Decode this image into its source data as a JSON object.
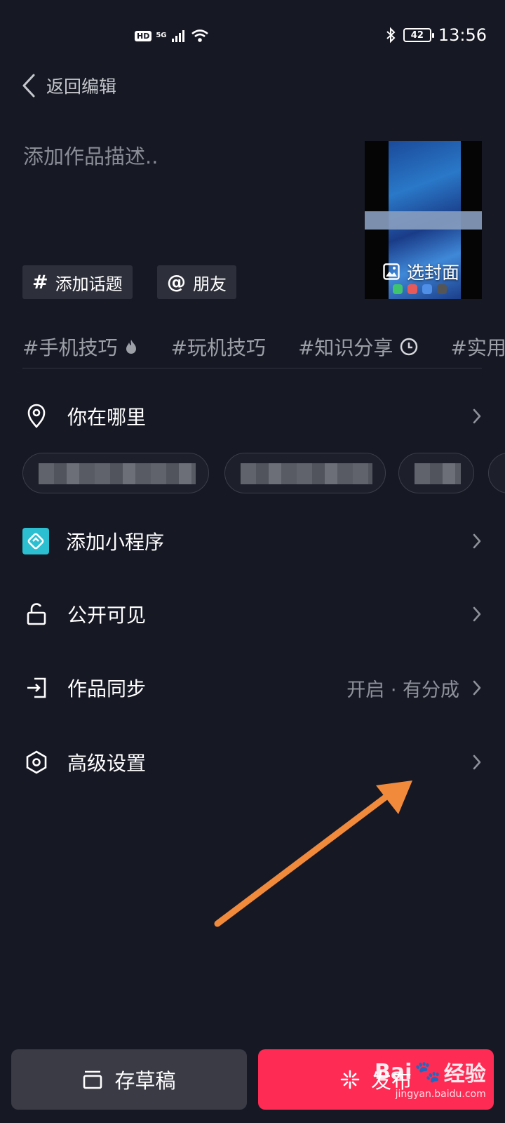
{
  "status_bar": {
    "hd": "HD",
    "network": "5G",
    "battery": "42",
    "time": "13:56"
  },
  "header": {
    "back_label": "返回编辑"
  },
  "description": {
    "placeholder": "添加作品描述.."
  },
  "cover": {
    "label": "选封面"
  },
  "chips": [
    {
      "symbol": "#",
      "label": "添加话题"
    },
    {
      "symbol": "@",
      "label": "朋友"
    }
  ],
  "hashtags": [
    {
      "label": "#手机技巧",
      "icon": "fire-icon"
    },
    {
      "label": "#玩机技巧",
      "icon": ""
    },
    {
      "label": "#知识分享",
      "icon": "clock-icon"
    },
    {
      "label": "#实用小",
      "icon": ""
    }
  ],
  "menu": {
    "location": {
      "label": "你在哪里",
      "icon": "location-pin-icon"
    },
    "mini_program": {
      "label": "添加小程序",
      "icon": "mini-program-icon"
    },
    "visibility": {
      "label": "公开可见",
      "icon": "unlock-icon"
    },
    "sync": {
      "label": "作品同步",
      "value": "开启 · 有分成",
      "icon": "sync-export-icon"
    },
    "advanced": {
      "label": "高级设置",
      "icon": "hexagon-settings-icon"
    }
  },
  "buttons": {
    "draft": "存草稿",
    "publish": "发布"
  },
  "watermark": {
    "brand": "Bai",
    "brand_suffix": "经验",
    "url": "jingyan.baidu.com"
  },
  "colors": {
    "background": "#161824",
    "publish": "#fe2c55",
    "arrow": "#f28a3c",
    "mini_program": "#2bbfd1"
  }
}
